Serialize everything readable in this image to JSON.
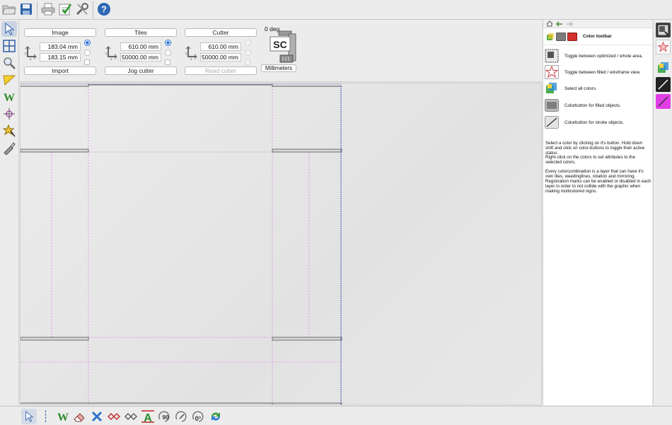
{
  "toolbar": {
    "icons": [
      "folder-icon",
      "save-icon",
      "printer-icon",
      "checklist-icon",
      "tools-icon",
      "help-icon"
    ]
  },
  "left_tools": [
    "pointer-tool-icon",
    "grid-tool-icon",
    "zoom-tool-icon",
    "measure-tool-icon",
    "weed-tool-icon",
    "registration-mark-icon",
    "star-transform-icon",
    "knife-tool-icon"
  ],
  "image_group": {
    "label": "Image",
    "width": "183.04 mm",
    "height": "183.15 mm",
    "action": "Import"
  },
  "tiles_group": {
    "label": "Tiles",
    "width": "610.00 mm",
    "height": "50000.00 mm",
    "action": "Jog cutter"
  },
  "cutter_group": {
    "label": "Cutter",
    "width": "610.00 mm",
    "height": "50000.00 mm",
    "action": "Read cutter"
  },
  "rotation": "0 deg",
  "logo_text": "SC",
  "units": "Millimeters",
  "right_panel": {
    "title": "Color toolbar",
    "rows": [
      {
        "icon": "optimize-area-icon",
        "text": "Toggle between optimized / whole area."
      },
      {
        "icon": "wireframe-star-icon",
        "text": "Toggle between filled / wireframe view."
      },
      {
        "icon": "select-all-colors-icon",
        "text": "Select all colors."
      },
      {
        "icon": "filled-color-icon",
        "text": "Colorbutton for filled objects."
      },
      {
        "icon": "stroke-color-icon",
        "text": "Colorbutton for stroke objects."
      }
    ],
    "help1": "Select a color by clicking on it's button. Hold down shift and click on color-buttons to toggle their active status.",
    "help2": "Right-click on the colors to set attributes to the selected colors.",
    "help3": "Every colorcombination is a layer that can have it's own tiles, weedinglines, rotation and mirroring. Registration marks can be enabled or disabled in each layer in order to not collide with the graphic when making multicolored signs."
  },
  "colors": {
    "accent": "#2a6fd6",
    "guide": "#d58ae0",
    "cut_line": "#3d4fa8",
    "magenta": "#e23ee6"
  },
  "bottom_tools": [
    "pointer-icon",
    "weed-icon",
    "eraser-icon",
    "delete-icon",
    "node-add-icon",
    "node-remove-icon",
    "text-outline-icon",
    "rotate-90-icon",
    "rotate-free-icon",
    "rotate-zero-icon",
    "refresh-icon"
  ],
  "bottom_labels": {
    "rot90": "90",
    "rot0": "0°"
  }
}
